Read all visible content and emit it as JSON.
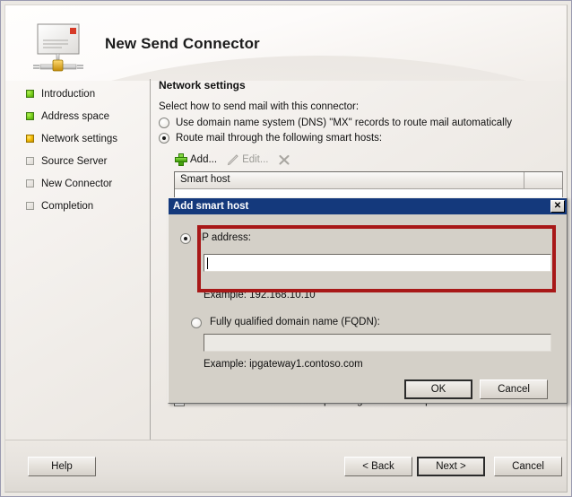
{
  "window": {
    "title": "New Send Connector",
    "icon": "send-connector-icon"
  },
  "sidebar": {
    "items": [
      {
        "label": "Introduction",
        "state": "done"
      },
      {
        "label": "Address space",
        "state": "done"
      },
      {
        "label": "Network settings",
        "state": "current"
      },
      {
        "label": "Source Server",
        "state": "todo"
      },
      {
        "label": "New Connector",
        "state": "todo"
      },
      {
        "label": "Completion",
        "state": "todo"
      }
    ]
  },
  "main": {
    "page_title": "Network settings",
    "intro": "Select how to send mail with this connector:",
    "radio_dns": {
      "label": "Use domain name system (DNS) \"MX\" records to route mail automatically",
      "checked": false
    },
    "radio_smart": {
      "label": "Route mail through the following smart hosts:",
      "checked": true
    },
    "toolbar": {
      "add_label": "Add...",
      "edit_label": "Edit...",
      "delete_label": "",
      "add_icon": "plus-icon",
      "edit_icon": "pencil-icon",
      "delete_icon": "x-delete-icon"
    },
    "list": {
      "columns": [
        "Smart host",
        ""
      ],
      "rows": []
    },
    "dns_lookup_checkbox": {
      "label": "Use the External DNS Lookup settings on the transport server",
      "checked": false
    }
  },
  "dialog": {
    "title": "Add smart host",
    "close_icon": "close-icon",
    "ip_radio": {
      "label": "IP address:",
      "checked": true
    },
    "ip_input": {
      "value": "",
      "placeholder": ""
    },
    "ip_example": "Example: 192.168.10.10",
    "fqdn_radio": {
      "label": "Fully qualified domain name (FQDN):",
      "checked": false
    },
    "fqdn_input": {
      "value": "",
      "placeholder": ""
    },
    "fqdn_example": "Example: ipgateway1.contoso.com",
    "ok_label": "OK",
    "cancel_label": "Cancel",
    "highlight_color": "#a81818"
  },
  "footer": {
    "help_label": "Help",
    "back_label": "< Back",
    "next_label": "Next >",
    "cancel_label": "Cancel"
  },
  "colors": {
    "titlebar": "#14397c",
    "dialog_face": "#d4d0c8",
    "highlight": "#a81818",
    "done": "#7ed321",
    "current": "#f5bd08"
  }
}
